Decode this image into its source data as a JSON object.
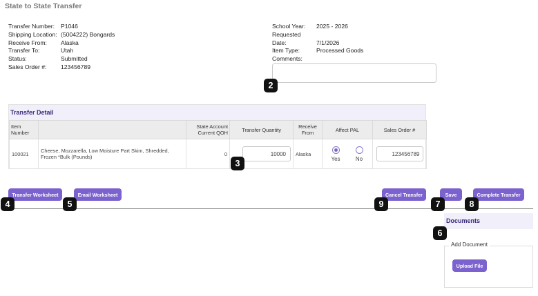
{
  "page": {
    "title": "State to State Transfer"
  },
  "left_info": [
    {
      "label": "Transfer Number:",
      "value": "P1046"
    },
    {
      "label": "Shipping Location:",
      "value": "(5004222) Bongards"
    },
    {
      "label": "Receive From:",
      "value": "Alaska"
    },
    {
      "label": "Transfer To:",
      "value": "Utah"
    },
    {
      "label": "Status:",
      "value": "Submitted"
    },
    {
      "label": "Sales Order #:",
      "value": "123456789"
    }
  ],
  "right_info": {
    "school_year_label": "School Year:",
    "school_year_value": "2025 - 2026",
    "requested_label": "Requested",
    "date_label": "Date:",
    "date_value": "7/1/2026",
    "item_type_label": "Item Type:",
    "item_type_value": "Processed Goods",
    "comments_label": "Comments:",
    "comments_value": ""
  },
  "transfer_detail": {
    "title": "Transfer Detail",
    "headers": {
      "item_number": "Item Number",
      "description": "",
      "qoh": "State Account Current QOH",
      "transfer_quantity": "Transfer Quantity",
      "receive_from": "Receive From",
      "affect_pal": "Affect PAL",
      "sales_order": "Sales Order #"
    },
    "row": {
      "item_number": "100021",
      "description": "Cheese, Mozzarella, Low Moisture Part Skim, Shredded, Frozen *Bulk (Pounds)",
      "qoh": "0",
      "transfer_quantity": "10000",
      "receive_from": "Alaska",
      "pal_yes": "Yes",
      "pal_no": "No",
      "pal_selected": "Yes",
      "sales_order": "123456789"
    }
  },
  "buttons": {
    "transfer_worksheet": "Transfer Worksheet",
    "email_worksheet": "Email Worksheet",
    "cancel_transfer": "Cancel Transfer",
    "save": "Save",
    "complete_transfer": "Complete Transfer",
    "upload_file": "Upload File"
  },
  "documents": {
    "title": "Documents",
    "add_document": "Add Document"
  },
  "callouts": {
    "c2": "2",
    "c3": "3",
    "c4": "4",
    "c5": "5",
    "c6": "6",
    "c7": "7",
    "c8": "8",
    "c9": "9"
  },
  "colors": {
    "accent": "#7b62cf",
    "header_tint": "#f1effa",
    "callout": "#111111"
  }
}
